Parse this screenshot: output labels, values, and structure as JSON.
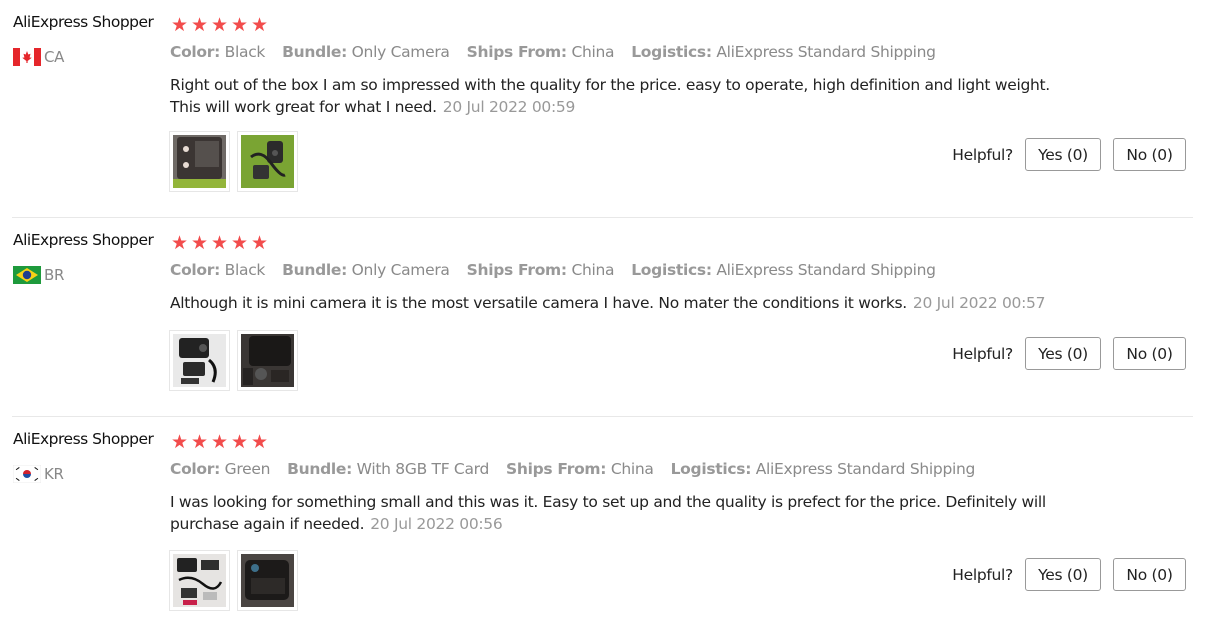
{
  "rating_color": "#f24c4c",
  "rating_max": 5,
  "helpful_label": "Helpful?",
  "reviews": [
    {
      "user": "AliExpress Shopper",
      "rating": 5,
      "country": "CA",
      "flag_icon": "canada-flag-icon",
      "attributes": [
        {
          "key": "Color:",
          "value": "Black"
        },
        {
          "key": "Bundle:",
          "value": "Only Camera"
        },
        {
          "key": "Ships From:",
          "value": "China"
        },
        {
          "key": "Logistics:",
          "value": "AliExpress Standard Shipping"
        }
      ],
      "text_lines": [
        "Right out of the box I am so impressed with the quality for the price. easy to operate, high definition and light weight.",
        "This will work great for what I need."
      ],
      "date": "20 Jul 2022 00:59",
      "photos": [
        "camera-photo-thumbnail",
        "accessories-photo-thumbnail"
      ],
      "yes_label": "Yes (0)",
      "no_label": "No (0)"
    },
    {
      "user": "AliExpress Shopper",
      "rating": 5,
      "country": "BR",
      "flag_icon": "brazil-flag-icon",
      "attributes": [
        {
          "key": "Color:",
          "value": "Black"
        },
        {
          "key": "Bundle:",
          "value": "Only Camera"
        },
        {
          "key": "Ships From:",
          "value": "China"
        },
        {
          "key": "Logistics:",
          "value": "AliExpress Standard Shipping"
        }
      ],
      "text_lines": [
        "Although it is mini camera it is the most versatile camera I have. No mater the conditions it works."
      ],
      "date": "20 Jul 2022 00:57",
      "photos": [
        "camera-photo-thumbnail",
        "camera-closeup-thumbnail"
      ],
      "yes_label": "Yes (0)",
      "no_label": "No (0)"
    },
    {
      "user": "AliExpress Shopper",
      "rating": 5,
      "country": "KR",
      "flag_icon": "south-korea-flag-icon",
      "attributes": [
        {
          "key": "Color:",
          "value": "Green"
        },
        {
          "key": "Bundle:",
          "value": "With 8GB TF Card"
        },
        {
          "key": "Ships From:",
          "value": "China"
        },
        {
          "key": "Logistics:",
          "value": "AliExpress Standard Shipping"
        }
      ],
      "text_lines": [
        "I was looking for something small and this was it. Easy to set up and the quality is prefect for the price. Definitely will",
        "purchase again if needed."
      ],
      "date": "20 Jul 2022 00:56",
      "photos": [
        "package-contents-thumbnail",
        "camera-closeup-thumbnail"
      ],
      "yes_label": "Yes (0)",
      "no_label": "No (0)"
    }
  ]
}
